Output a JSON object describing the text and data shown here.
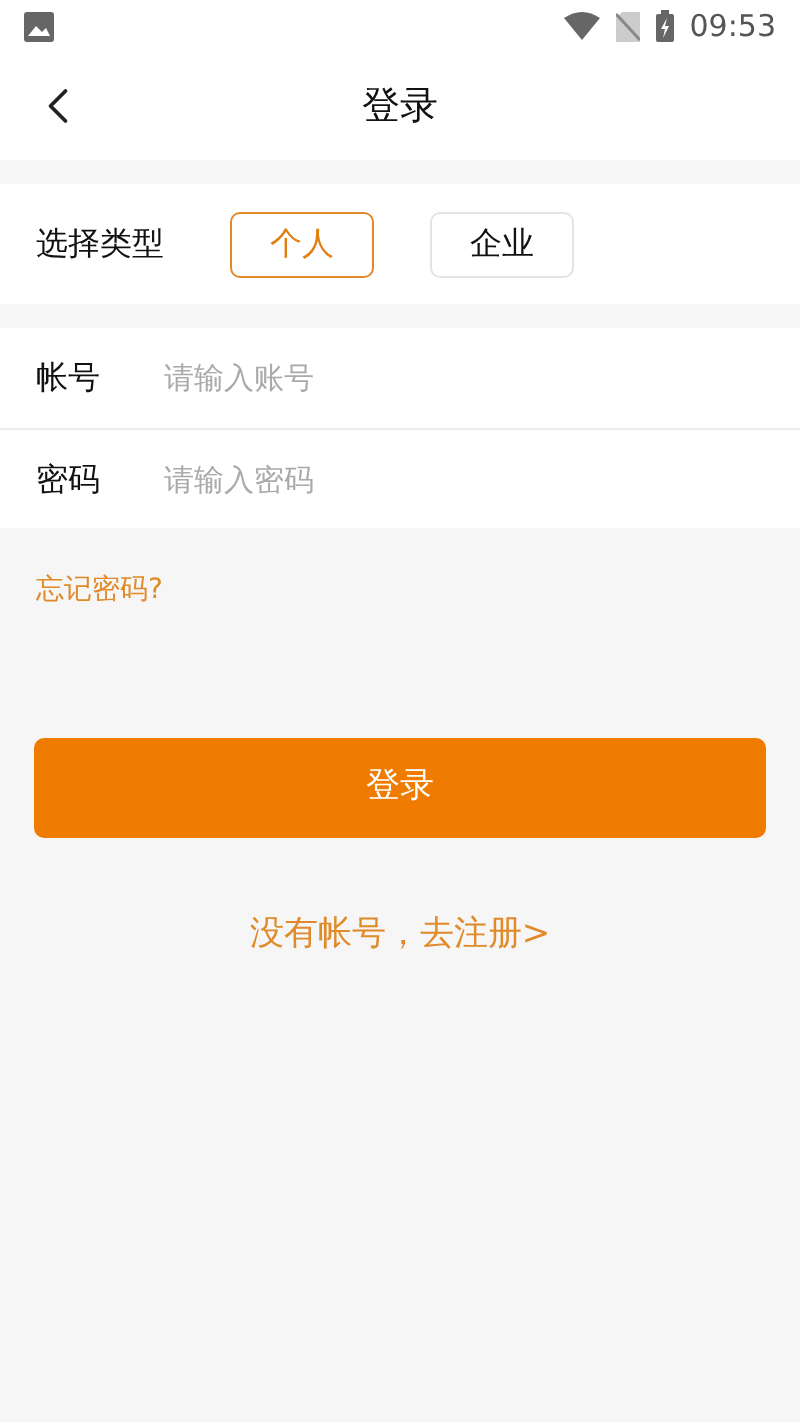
{
  "status_bar": {
    "time": "09:53"
  },
  "header": {
    "title": "登录"
  },
  "type_selector": {
    "label": "选择类型",
    "options": [
      {
        "label": "个人",
        "selected": true
      },
      {
        "label": "企业",
        "selected": false
      }
    ]
  },
  "fields": [
    {
      "label": "帐号",
      "placeholder": "请输入账号"
    },
    {
      "label": "密码",
      "placeholder": "请输入密码"
    }
  ],
  "forgot_link": "忘记密码?",
  "login_button": "登录",
  "register_link": "没有帐号，去注册>"
}
